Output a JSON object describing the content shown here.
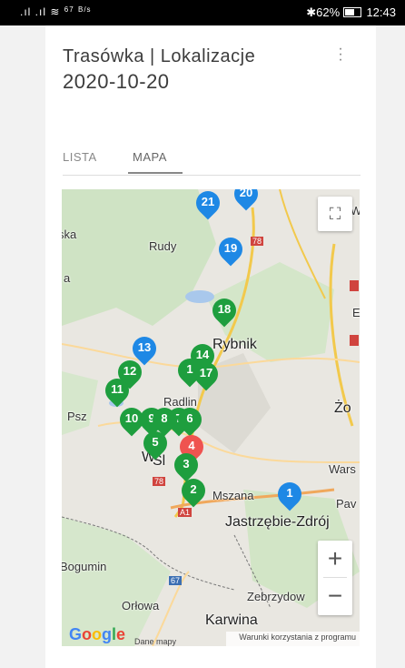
{
  "status_bar": {
    "left_signal": ".ıl .ıl",
    "speed_value": "67",
    "speed_unit": "B/s",
    "battery": "62%",
    "time": "12:43"
  },
  "header": {
    "title": "Trasówka | Lokalizacje",
    "date": "2020-10-20"
  },
  "tabs": [
    {
      "label": "LISTA",
      "active": false
    },
    {
      "label": "MAPA",
      "active": true
    }
  ],
  "map": {
    "labels": {
      "rudy": "Rudy",
      "rybnik": "Rybnik",
      "radlin": "Radlin",
      "psz": "Psz",
      "zo": "Żo",
      "wars": "Wars",
      "mszana": "Mszana",
      "pav": "Pav",
      "jastrzebie": "Jastrzębie-Zdrój",
      "bogumin": "Bogumin",
      "orlowa": "Orłowa",
      "zebrzydow": "Zebrzydow",
      "karwina": "Karwina",
      "ska": "ska",
      "a": "a",
      "w_top": "W",
      "e": "E",
      "sla": "Śl",
      "wodz": "W",
      "shield78a": "78",
      "shield78b": "78",
      "shield67": "67",
      "shieldA1": "A1"
    },
    "pins": [
      {
        "num": "21",
        "color": "#1e88e5"
      },
      {
        "num": "20",
        "color": "#1e88e5"
      },
      {
        "num": "19",
        "color": "#1e88e5"
      },
      {
        "num": "18",
        "color": "#1e9e3e"
      },
      {
        "num": "13",
        "color": "#1e88e5"
      },
      {
        "num": "14",
        "color": "#1e9e3e"
      },
      {
        "num": "12",
        "color": "#1e9e3e"
      },
      {
        "num": "1",
        "color": "#1e9e3e"
      },
      {
        "num": "17",
        "color": "#1e9e3e"
      },
      {
        "num": "11",
        "color": "#1e9e3e"
      },
      {
        "num": "10",
        "color": "#1e9e3e"
      },
      {
        "num": "9",
        "color": "#1e9e3e"
      },
      {
        "num": "8",
        "color": "#1e9e3e"
      },
      {
        "num": "7",
        "color": "#1e9e3e"
      },
      {
        "num": "6",
        "color": "#1e9e3e"
      },
      {
        "num": "4",
        "color": "#ef5350"
      },
      {
        "num": "5",
        "color": "#1e9e3e"
      },
      {
        "num": "3",
        "color": "#1e9e3e"
      },
      {
        "num": "2",
        "color": "#1e9e3e"
      },
      {
        "num": "1",
        "color": "#1e88e5"
      }
    ],
    "zoom_in": "+",
    "zoom_out": "−",
    "google_logo": "Google",
    "attribution_data": "Dane mapy",
    "attribution_terms": "Warunki korzystania z programu"
  }
}
